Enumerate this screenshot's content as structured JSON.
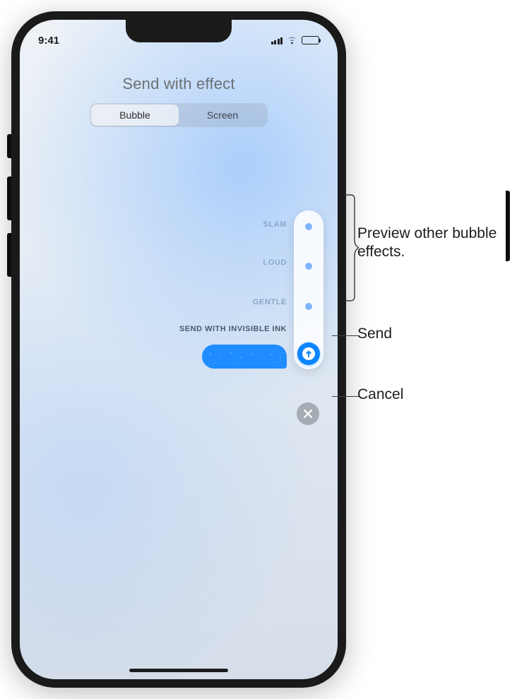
{
  "status": {
    "time": "9:41"
  },
  "header": {
    "title": "Send with effect",
    "tabs": [
      {
        "label": "Bubble",
        "active": true
      },
      {
        "label": "Screen",
        "active": false
      }
    ]
  },
  "effects": {
    "items": [
      {
        "label": "SLAM",
        "selected": false
      },
      {
        "label": "LOUD",
        "selected": false
      },
      {
        "label": "GENTLE",
        "selected": false
      }
    ],
    "selected_label": "SEND WITH INVISIBLE INK"
  },
  "callouts": {
    "preview": "Preview other bubble effects.",
    "send": "Send",
    "cancel": "Cancel"
  },
  "colors": {
    "accent": "#0a84ff",
    "bubble": "#1f8cff",
    "dot": "#7fb4ff"
  }
}
